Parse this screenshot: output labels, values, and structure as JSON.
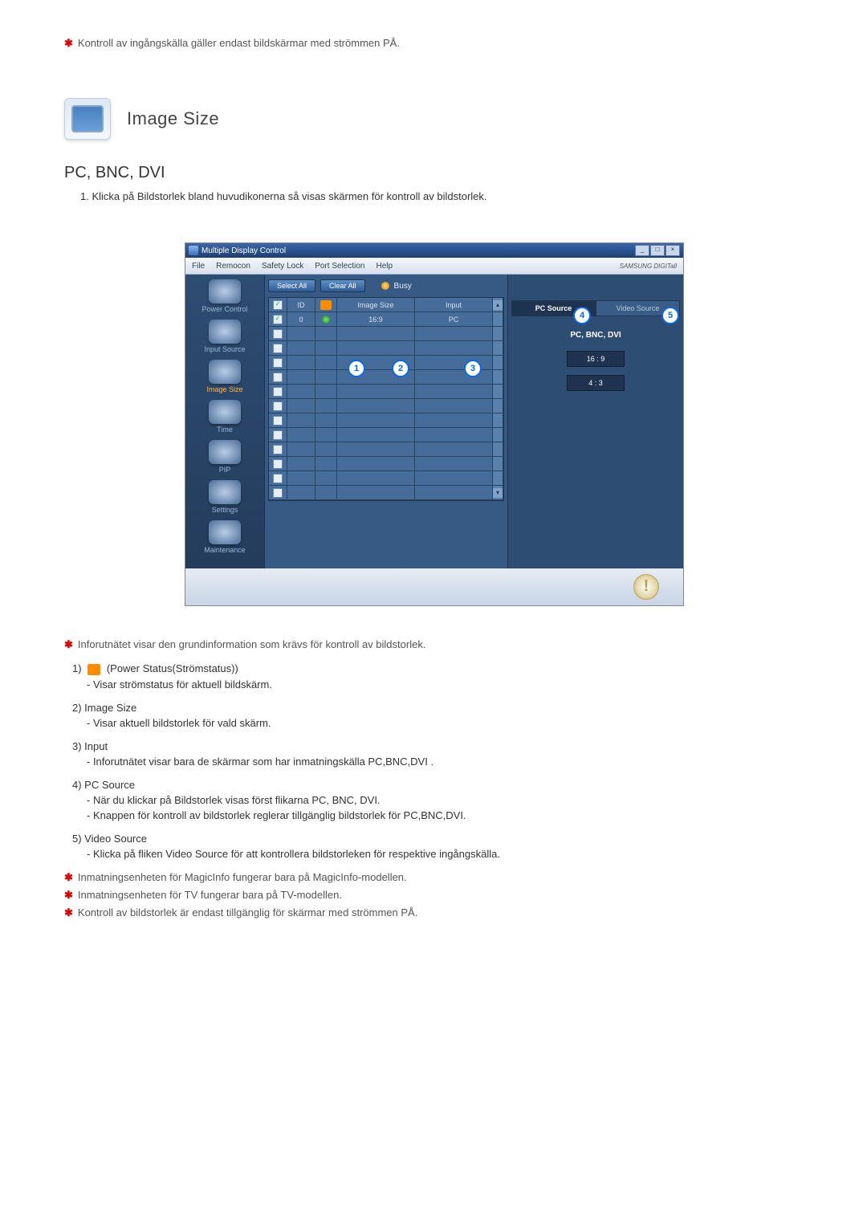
{
  "intro_note": "Kontroll av ingångskälla gäller endast bildskärmar med strömmen PÅ.",
  "section_title": "Image Size",
  "subheading": "PC, BNC, DVI",
  "step1": "1.  Klicka på Bildstorlek bland huvudikonerna så visas skärmen för kontroll av bildstorlek.",
  "app": {
    "title": "Multiple Display Control",
    "brand": "SAMSUNG DIGITall",
    "menus": [
      "File",
      "Remocon",
      "Safety Lock",
      "Port Selection",
      "Help"
    ],
    "sidebar": [
      {
        "label": "Power Control"
      },
      {
        "label": "Input Source"
      },
      {
        "label": "Image Size",
        "active": true
      },
      {
        "label": "Time"
      },
      {
        "label": "PIP"
      },
      {
        "label": "Settings"
      },
      {
        "label": "Maintenance"
      }
    ],
    "buttons": {
      "select_all": "Select All",
      "clear_all": "Clear All",
      "busy": "Busy"
    },
    "grid": {
      "headers": {
        "id": "ID",
        "image_size": "Image Size",
        "input": "Input"
      },
      "row0": {
        "id": "0",
        "image_size": "16:9",
        "input": "PC"
      }
    },
    "tabs": {
      "pc_source": "PC Source",
      "video_source": "Video Source"
    },
    "right_title": "PC, BNC, DVI",
    "ratios": {
      "r169": "16 : 9",
      "r43": "4 : 3"
    }
  },
  "callouts": {
    "c1": "1",
    "c2": "2",
    "c3": "3",
    "c4": "4",
    "c5": "5"
  },
  "expl": {
    "line0": "Inforutnätet visar den grundinformation som krävs för kontroll av bildstorlek.",
    "i1_label": "1)",
    "i1_text": "(Power Status(Strömstatus))",
    "i1_sub": "- Visar strömstatus för aktuell bildskärm.",
    "i2_label": "2)  Image Size",
    "i2_sub": "- Visar aktuell bildstorlek för vald skärm.",
    "i3_label": "3)  Input",
    "i3_sub": "- Inforutnätet visar bara de skärmar som har inmatningskälla PC,BNC,DVI .",
    "i4_label": "4)  PC Source",
    "i4_sub1": "- När du klickar på Bildstorlek visas först flikarna PC, BNC, DVI.",
    "i4_sub2": "- Knappen för kontroll av bildstorlek reglerar tillgänglig bildstorlek för PC,BNC,DVI.",
    "i5_label": "5)  Video Source",
    "i5_sub": "- Klicka på fliken Video Source för att kontrollera bildstorleken för respektive ingångskälla.",
    "note1": "Inmatningsenheten för MagicInfo fungerar bara på MagicInfo-modellen.",
    "note2": "Inmatningsenheten för TV fungerar bara på TV-modellen.",
    "note3": "Kontroll av bildstorlek är endast tillgänglig för skärmar med strömmen PÅ."
  }
}
